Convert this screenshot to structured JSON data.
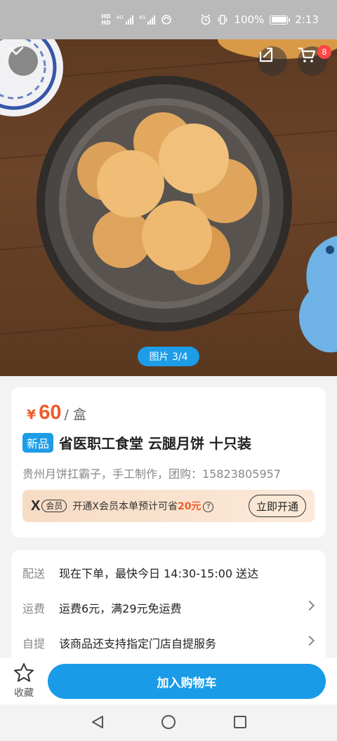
{
  "status_bar": {
    "hd_top": "HD",
    "hd_bottom": "HD",
    "net1": "4G",
    "net2": "4G",
    "battery": "100%",
    "time": "2:13"
  },
  "hero": {
    "image_counter": "图片 3/4",
    "cart_badge": "8",
    "icons": [
      "chevron-down-icon",
      "share-icon",
      "cart-icon"
    ]
  },
  "product": {
    "currency": "¥",
    "price": "60",
    "unit": "/ 盒",
    "tag": "新品",
    "title": "省医职工食堂 云腿月饼 十只装",
    "subtitle": "贵州月饼扛霸子，手工制作，团购：15823805957",
    "vip": {
      "logo_x": "X",
      "logo_label": "会员",
      "text_prefix": "开通X会员本单预计可省",
      "save_amount": "20元",
      "help": "?",
      "button": "立即开通"
    }
  },
  "info": [
    {
      "label": "配送",
      "value": "现在下单，最快今日 14:30-15:00 送达",
      "chevron": false
    },
    {
      "label": "运费",
      "value": "运费6元，满29元免运费",
      "chevron": true
    },
    {
      "label": "自提",
      "value": "该商品还支持指定门店自提服务",
      "chevron": true
    }
  ],
  "bottom_bar": {
    "favorite_label": "收藏",
    "add_to_cart": "加入购物车"
  },
  "colors": {
    "accent_blue": "#1a9be8",
    "price_orange": "#f05a28",
    "badge_red": "#ff4747"
  }
}
